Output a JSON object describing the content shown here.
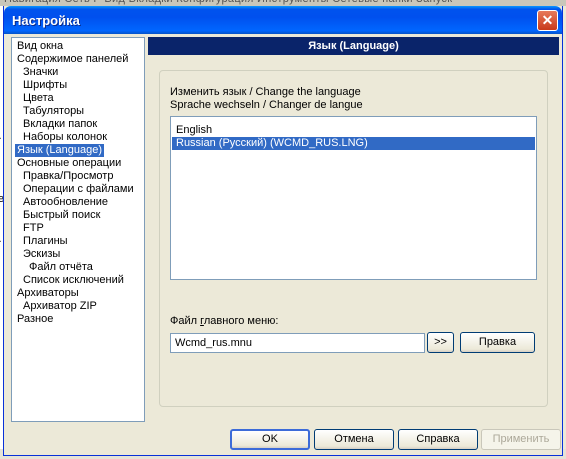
{
  "window": {
    "title": "Настройка",
    "close_label": "✕"
  },
  "tree": {
    "items": [
      {
        "label": "Вид окна",
        "indent": 0,
        "selected": false
      },
      {
        "label": "Содержимое панелей",
        "indent": 0,
        "selected": false
      },
      {
        "label": "Значки",
        "indent": 1,
        "selected": false
      },
      {
        "label": "Шрифты",
        "indent": 1,
        "selected": false
      },
      {
        "label": "Цвета",
        "indent": 1,
        "selected": false
      },
      {
        "label": "Табуляторы",
        "indent": 1,
        "selected": false
      },
      {
        "label": "Вкладки папок",
        "indent": 1,
        "selected": false
      },
      {
        "label": "Наборы колонок",
        "indent": 1,
        "selected": false
      },
      {
        "label": "Язык (Language)",
        "indent": 0,
        "selected": true
      },
      {
        "label": "Основные операции",
        "indent": 0,
        "selected": false
      },
      {
        "label": "Правка/Просмотр",
        "indent": 1,
        "selected": false
      },
      {
        "label": "Операции с файлами",
        "indent": 1,
        "selected": false
      },
      {
        "label": "Автообновление",
        "indent": 1,
        "selected": false
      },
      {
        "label": "Быстрый поиск",
        "indent": 1,
        "selected": false
      },
      {
        "label": "FTP",
        "indent": 1,
        "selected": false
      },
      {
        "label": "Плагины",
        "indent": 1,
        "selected": false
      },
      {
        "label": "Эскизы",
        "indent": 1,
        "selected": false
      },
      {
        "label": "Файл отчёта",
        "indent": 2,
        "selected": false
      },
      {
        "label": "Список исключений",
        "indent": 1,
        "selected": false
      },
      {
        "label": "Архиваторы",
        "indent": 0,
        "selected": false
      },
      {
        "label": "Архиватор ZIP",
        "indent": 1,
        "selected": false
      },
      {
        "label": "Разное",
        "indent": 0,
        "selected": false
      }
    ]
  },
  "panel": {
    "header": "Язык (Language)",
    "change_language_line1": "Изменить язык / Change the language",
    "change_language_line2": "Sprache wechseln / Changer de langue",
    "languages": [
      {
        "label": "English",
        "selected": false
      },
      {
        "label": "Russian (Русский) (WCMD_RUS.LNG)",
        "selected": true
      }
    ],
    "menu_file_label_pre": "Файл ",
    "menu_file_label_u": "г",
    "menu_file_label_post": "лавного меню:",
    "menu_file_value": "Wcmd_rus.mnu",
    "browse_label": ">>",
    "edit_label": "Правка"
  },
  "footer": {
    "ok_label": "OK",
    "cancel_label": "Отмена",
    "help_label": "Справка",
    "apply_label": "Применить"
  },
  "colors": {
    "selection": "#316ac5",
    "header_bg": "#0a246a",
    "titlebar": "#0053ee"
  }
}
